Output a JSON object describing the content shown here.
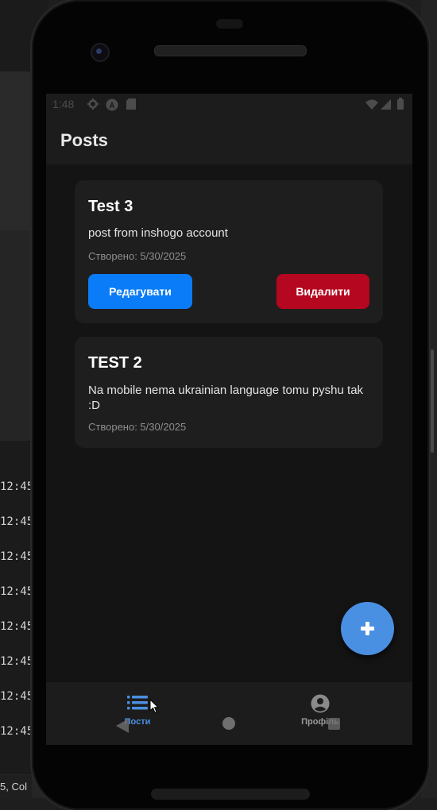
{
  "background": {
    "log_timestamps": [
      "12:45",
      "12:45",
      "12:45",
      "12:45",
      "12:45",
      "12:45",
      "12:45",
      "12:45"
    ],
    "status_col": "5, Col"
  },
  "status_bar": {
    "time": "1:48"
  },
  "app": {
    "title": "Posts"
  },
  "posts": [
    {
      "title": "Test 3",
      "body": "post from inshogo account",
      "date": "Створено: 5/30/2025",
      "edit_label": "Редагувати",
      "delete_label": "Видалити"
    },
    {
      "title": "TEST 2",
      "body": "Na mobile nema ukrainian language tomu pyshu tak :D",
      "date": "Створено: 5/30/2025"
    }
  ],
  "fab": {
    "icon": "plus-icon"
  },
  "bottom_nav": {
    "items": [
      {
        "label": "Пости",
        "icon": "list-icon",
        "active": true
      },
      {
        "label": "Профіль",
        "icon": "account-circle-icon",
        "active": false
      }
    ]
  },
  "colors": {
    "accent": "#4a90e2",
    "edit_button": "#0a7cf7",
    "delete_button": "#b5071f",
    "surface": "#1e1e1e",
    "background": "#141414"
  }
}
